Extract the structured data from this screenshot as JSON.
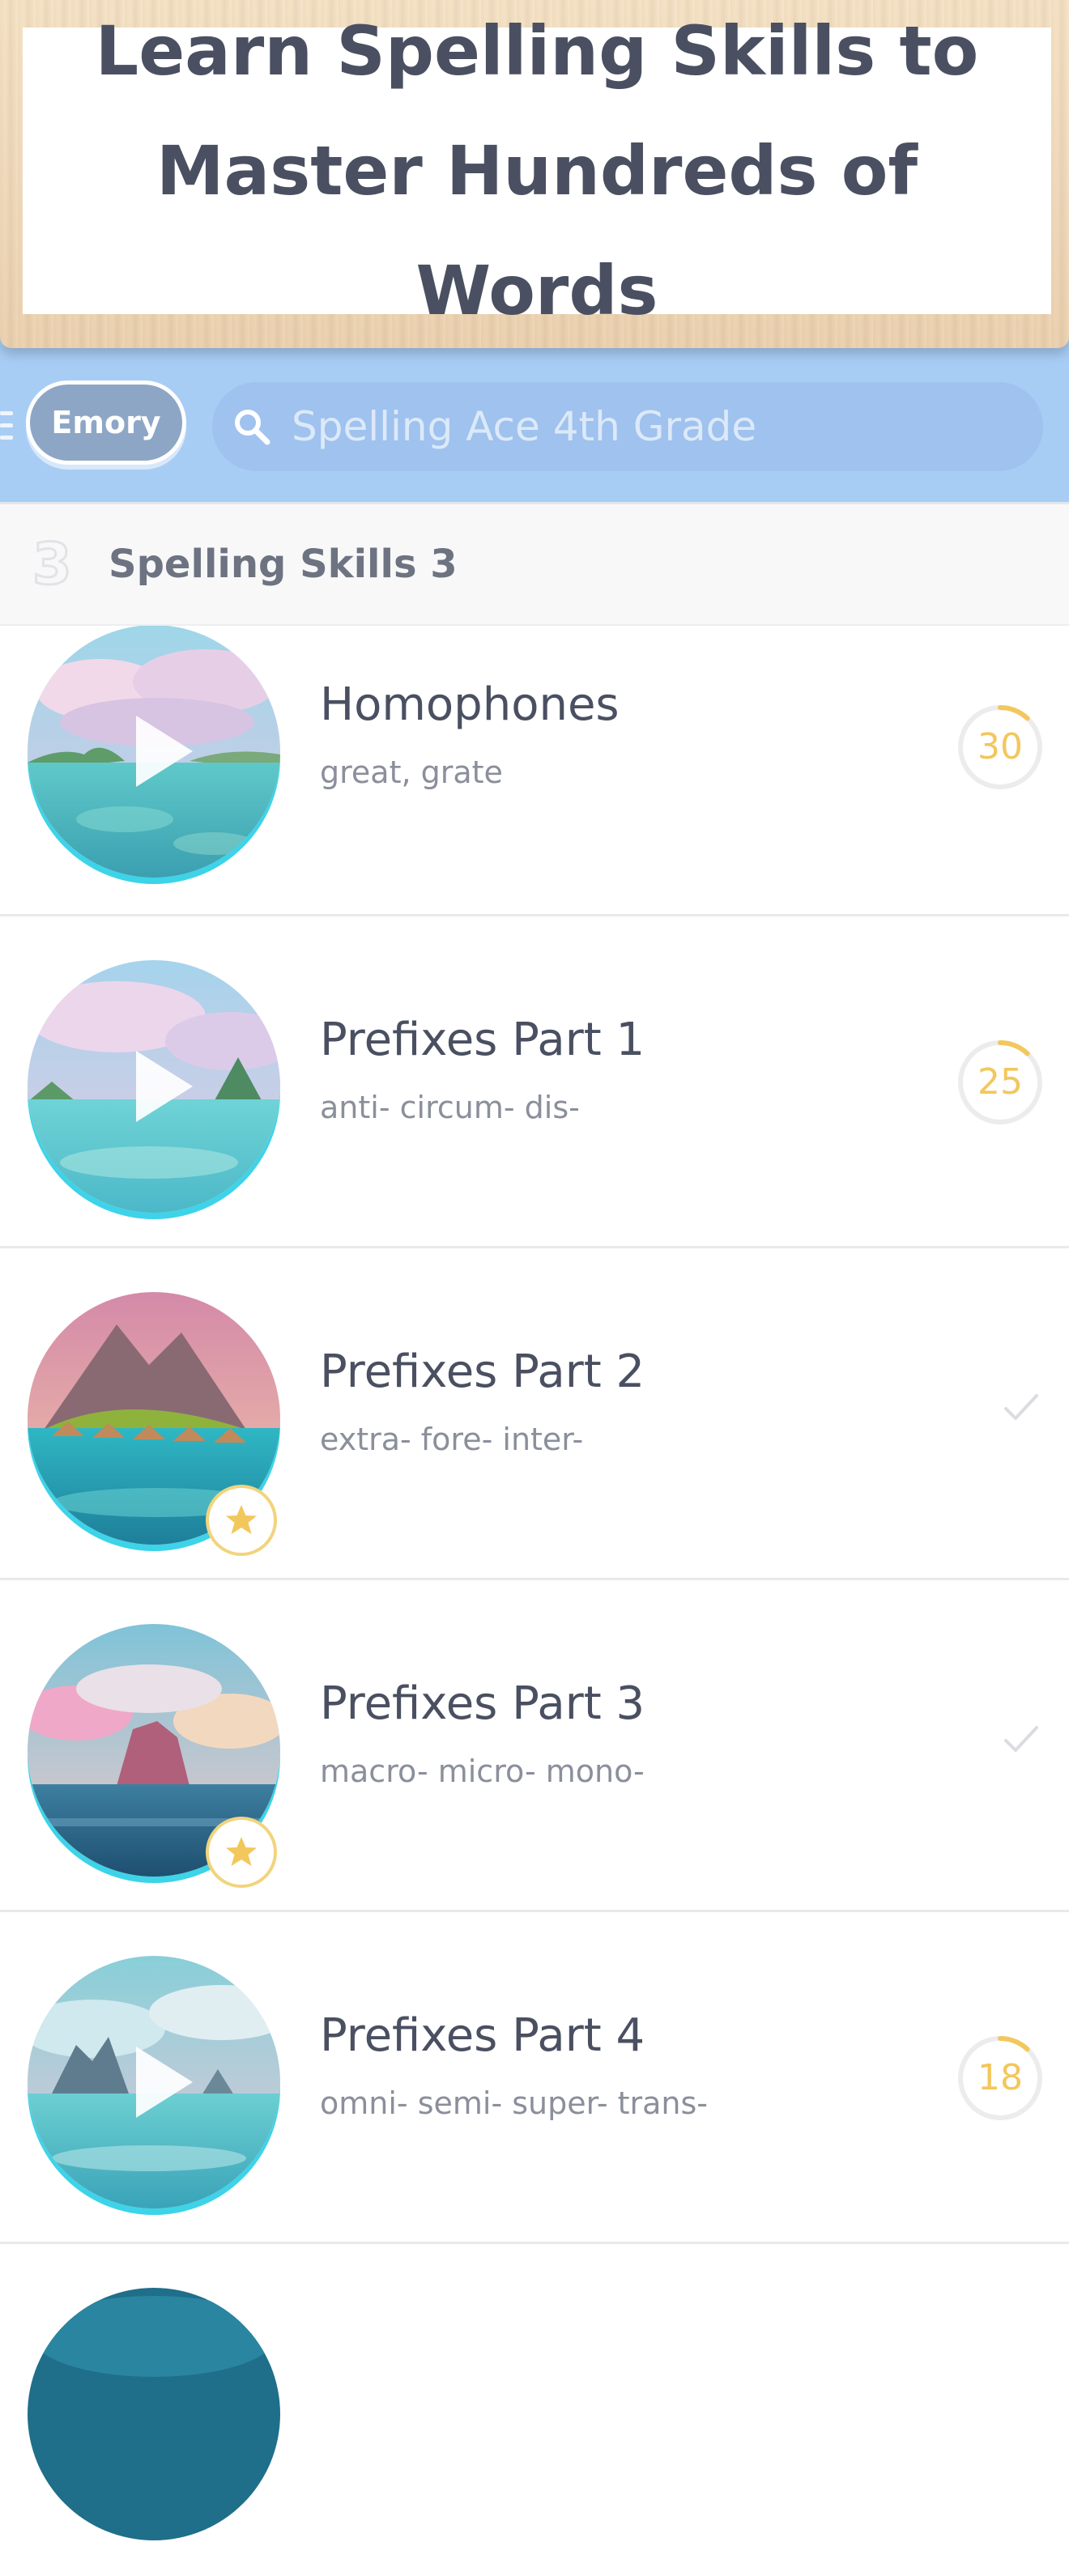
{
  "banner": {
    "title_line1": "Learn Spelling Skills to",
    "title_line2": "Master Hundreds of Words"
  },
  "header": {
    "user_name": "Emory",
    "search_placeholder": "Spelling Ace 4th Grade"
  },
  "section": {
    "number": "3",
    "title": "Spelling Skills 3"
  },
  "lessons": [
    {
      "title": "Homophones",
      "subtitle": "great, grate",
      "count": "30",
      "status": "in-progress",
      "thumbnail_icon": "play-icon",
      "progress_fraction": 0.12
    },
    {
      "title": "Prefixes Part 1",
      "subtitle": "anti- circum- dis-",
      "count": "25",
      "status": "in-progress",
      "thumbnail_icon": "play-icon",
      "progress_fraction": 0.12
    },
    {
      "title": "Prefixes Part 2",
      "subtitle": "extra- fore- inter-",
      "status": "completed",
      "thumbnail_icon": "star-icon"
    },
    {
      "title": "Prefixes Part 3",
      "subtitle": "macro- micro- mono-",
      "status": "completed",
      "thumbnail_icon": "star-icon"
    },
    {
      "title": "Prefixes Part 4",
      "subtitle": "omni- semi- super- trans-",
      "count": "18",
      "status": "in-progress",
      "thumbnail_icon": "play-icon",
      "progress_fraction": 0.12
    }
  ],
  "colors": {
    "accent_yellow": "#f2c75c",
    "header_blue": "#a8cdf5",
    "thumb_ring": "#3dd3e8",
    "text_dark": "#4a5061",
    "text_muted": "#8a8f9b"
  }
}
